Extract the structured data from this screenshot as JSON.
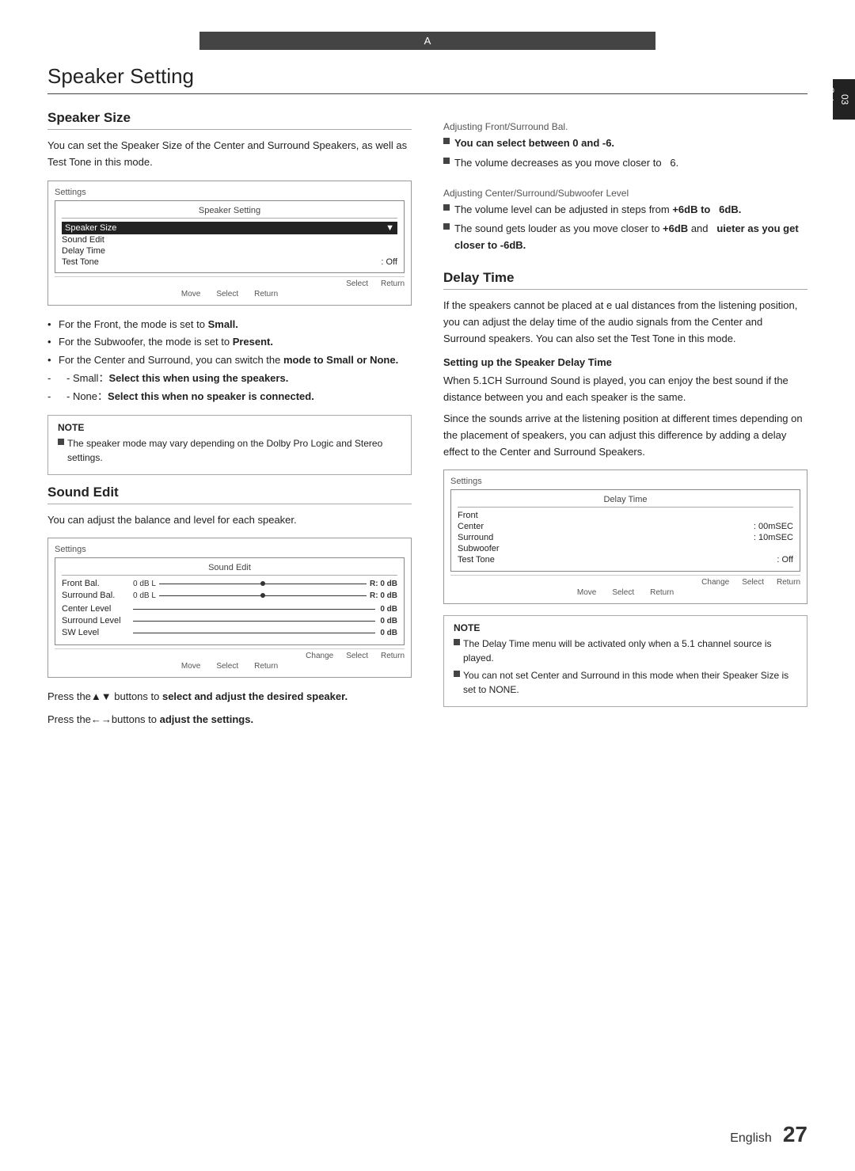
{
  "page": {
    "section_a_label": "A",
    "main_title": "Speaker Setting",
    "side_tab_top": "03",
    "side_tab_bottom": "Setup",
    "page_number": "27",
    "page_number_word": "English"
  },
  "left": {
    "speaker_size": {
      "heading": "Speaker Size",
      "description": "You can set the Speaker Size of the Center and Surround Speakers, as well as Test Tone in this mode.",
      "settings_label": "Settings",
      "inner_title": "Speaker Setting",
      "rows": [
        {
          "label": "Speaker Size",
          "value": "▼",
          "selected": true
        },
        {
          "label": "Sound Edit",
          "value": ""
        },
        {
          "label": "Delay Time",
          "value": ""
        },
        {
          "label": "Test Tone",
          "value": ": Off"
        }
      ],
      "footer_items": [
        "Select",
        "Return"
      ],
      "footer2_items": [
        "Move",
        "Select",
        "Return"
      ]
    },
    "bullet_items": [
      "For the Front, the mode is set to Small.",
      "For the Subwoofer, the mode is set to Present.",
      "For the Center and Surround, you can switch the mode to Small or None.",
      "- Small：Select this when using the speakers.",
      "- None：Select this when no speaker is connected."
    ],
    "note": {
      "title": "NOTE",
      "item": "The speaker mode may vary depending on the Dolby Pro Logic and Stereo settings."
    },
    "sound_edit": {
      "heading": "Sound Edit",
      "description": "You can adjust the balance and level for each speaker.",
      "settings_label": "Settings",
      "inner_title": "Sound Edit",
      "front_bal_label": "Front Bal.",
      "front_bal_left": "0 dB L",
      "front_bal_right": "R: 0 dB",
      "surround_bal_label": "Surround Bal.",
      "surround_bal_left": "0 dB L",
      "surround_bal_right": "R: 0 dB",
      "levels": [
        {
          "label": "Center Level",
          "value": "0 dB"
        },
        {
          "label": "Surround Level",
          "value": "0 dB"
        },
        {
          "label": "SW Level",
          "value": "0 dB"
        }
      ],
      "footer_items": [
        "Change",
        "Select",
        "Return"
      ],
      "footer2_items": [
        "Move",
        "Select",
        "Return"
      ]
    },
    "press_texts": [
      "Press the▲▼ buttons to select and adjust the desired speaker.",
      "Press the←→buttons to adjust the settings."
    ]
  },
  "right": {
    "adjusting_front": {
      "label": "Adjusting Front/Surround Bal.",
      "bullets": [
        "You can select between 0 and -6.",
        "The volume decreases as you move closer to   6."
      ]
    },
    "adjusting_center": {
      "label": "Adjusting Center/Surround/Subwoofer Level",
      "bullets": [
        "The volume level can be adjusted in steps from +6dB to   6dB.",
        "The sound gets louder as you move closer to +6dB and   uieter as you get closer to -6dB."
      ]
    },
    "delay_time": {
      "heading": "Delay Time",
      "description": "If the speakers cannot be placed at e  ual distances from the listening position, you can adjust the delay time of the audio signals from the Center and Surround speakers. You can also set the Test Tone in this mode.",
      "subsection": "Setting up the Speaker Delay Time",
      "subsection_text": "When 5.1CH Surround Sound is played, you can enjoy the best sound if the distance between you and each speaker is the same.",
      "subsection_text2": "Since the sounds arrive at the listening position at different times depending on the placement of speakers, you can adjust this difference by adding a delay effect to the Center and Surround Speakers.",
      "settings_label": "Settings",
      "inner_title": "Delay Time",
      "rows": [
        {
          "label": "Front",
          "value": ""
        },
        {
          "label": "Center",
          "value": ": 00mSEC"
        },
        {
          "label": "Surround",
          "value": ": 10mSEC"
        },
        {
          "label": "Subwoofer",
          "value": ""
        },
        {
          "label": "Test Tone",
          "value": ": Off"
        }
      ],
      "footer_items": [
        "Change",
        "Select",
        "Return"
      ],
      "footer2_items": [
        "Move",
        "Select",
        "Return"
      ]
    },
    "note2": {
      "title": "NOTE",
      "items": [
        "The Delay Time menu will be activated only when a 5.1 channel source is played.",
        "You can not set Center and Surround in this mode when their Speaker Size is set to NONE."
      ]
    }
  }
}
